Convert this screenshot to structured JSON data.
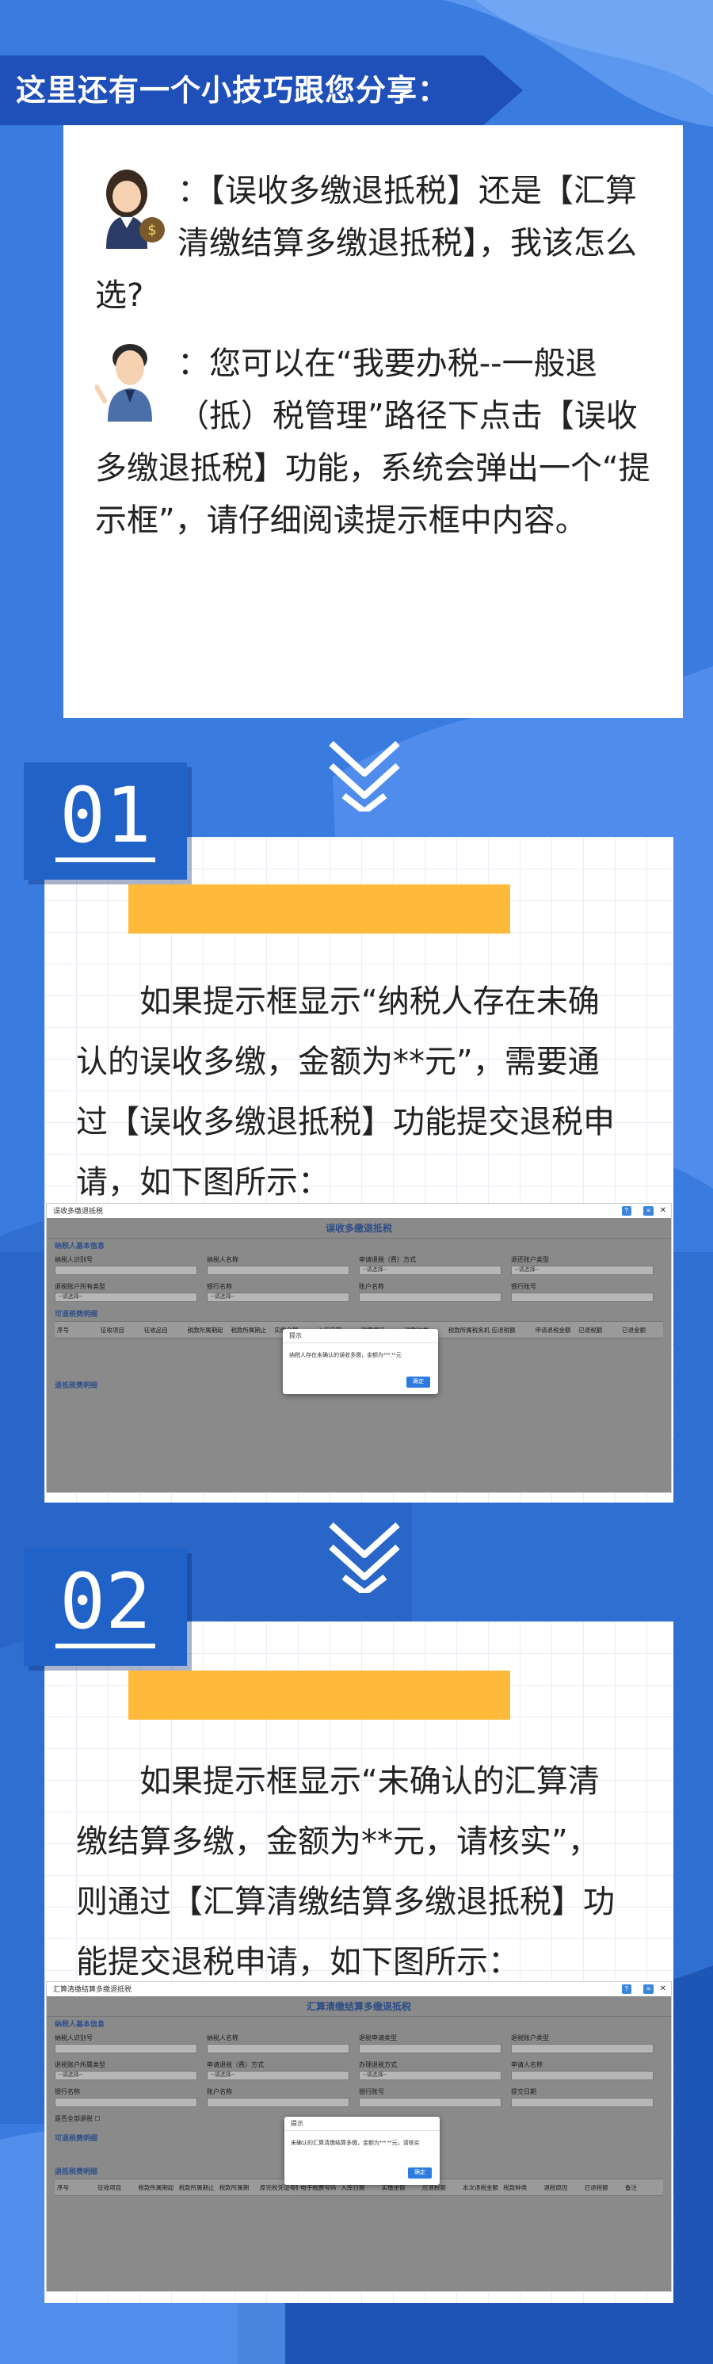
{
  "tip": {
    "banner": "这里还有一个小技巧跟您分享：",
    "question": "：【误收多缴退抵税】还是【汇算清缴结算多缴退抵税】，我该怎么选?",
    "answer": "：您可以在“我要办税--一般退（抵）税管理”路径下点击【误收多缴退抵税】功能，系统会弹出一个“提示框”，请仔细阅读提示框中内容。"
  },
  "step1": {
    "number": "01",
    "text": "如果提示框显示“纳税人存在未确认的误收多缴，金额为**元”，需要通过【误收多缴退抵税】功能提交退税申请，如下图所示："
  },
  "step2": {
    "number": "02",
    "text": "如果提示框显示“未确认的汇算清缴结算多缴，金额为**元，请核实”，则通过【汇算清缴结算多缴退抵税】功能提交退税申请，如下图所示："
  },
  "shot1": {
    "window_title": "误收多缴退抵税",
    "title": "误收多缴退抵税",
    "section1": "纳税人基本信息",
    "section2": "可退税费明细",
    "section3": "退抵税费明细",
    "labels": [
      "纳税人识别号",
      "纳税人名称",
      "申请退税（费）方式",
      "退还账户类型",
      "退税账户所有类型",
      "银行名称",
      "账户名称",
      "银行账号"
    ],
    "select_placeholder": "--请选择--",
    "columns": [
      "序号",
      "征收项目",
      "征收品目",
      "税款所属期起",
      "税款所属期止",
      "实缴金额",
      "入库日期",
      "税票号码",
      "税款种类",
      "税款所属税务机关",
      "应退税额",
      "申请退税金额",
      "已退税额",
      "已退金额"
    ],
    "dialog_title": "提示",
    "dialog_msg": "纳税人存在未确认的误收多缴，金额为***.**元",
    "dialog_btn": "确定"
  },
  "shot2": {
    "window_title": "汇算清缴结算多缴退抵税",
    "title": "汇算清缴结算多缴退抵税",
    "section1": "纳税人基本信息",
    "section2": "可退税费明细",
    "section3": "退抵税费明细",
    "labels": [
      "纳税人识别号",
      "纳税人名称",
      "退税申请类型",
      "退税账户类型",
      "退税账户所属类型",
      "申请退税（费）方式",
      "办理退税方式",
      "申请人名称",
      "银行名称",
      "账户名称",
      "银行账号",
      "提交日期",
      "是否全部退税"
    ],
    "select_placeholder": "--请选择--",
    "columns": [
      "序号",
      "征收项目",
      "税款所属期起",
      "税款所属期止",
      "税款所属期",
      "原完税凭证号码",
      "电子税票号码",
      "入库日期",
      "实缴金额",
      "应退税额",
      "本次退税金额",
      "税款种类",
      "退税原因",
      "已退税额",
      "备注"
    ],
    "dialog_title": "提示",
    "dialog_msg": "未确认的汇算清缴结算多缴，金额为***.**元，请核实",
    "dialog_btn": "确定"
  }
}
